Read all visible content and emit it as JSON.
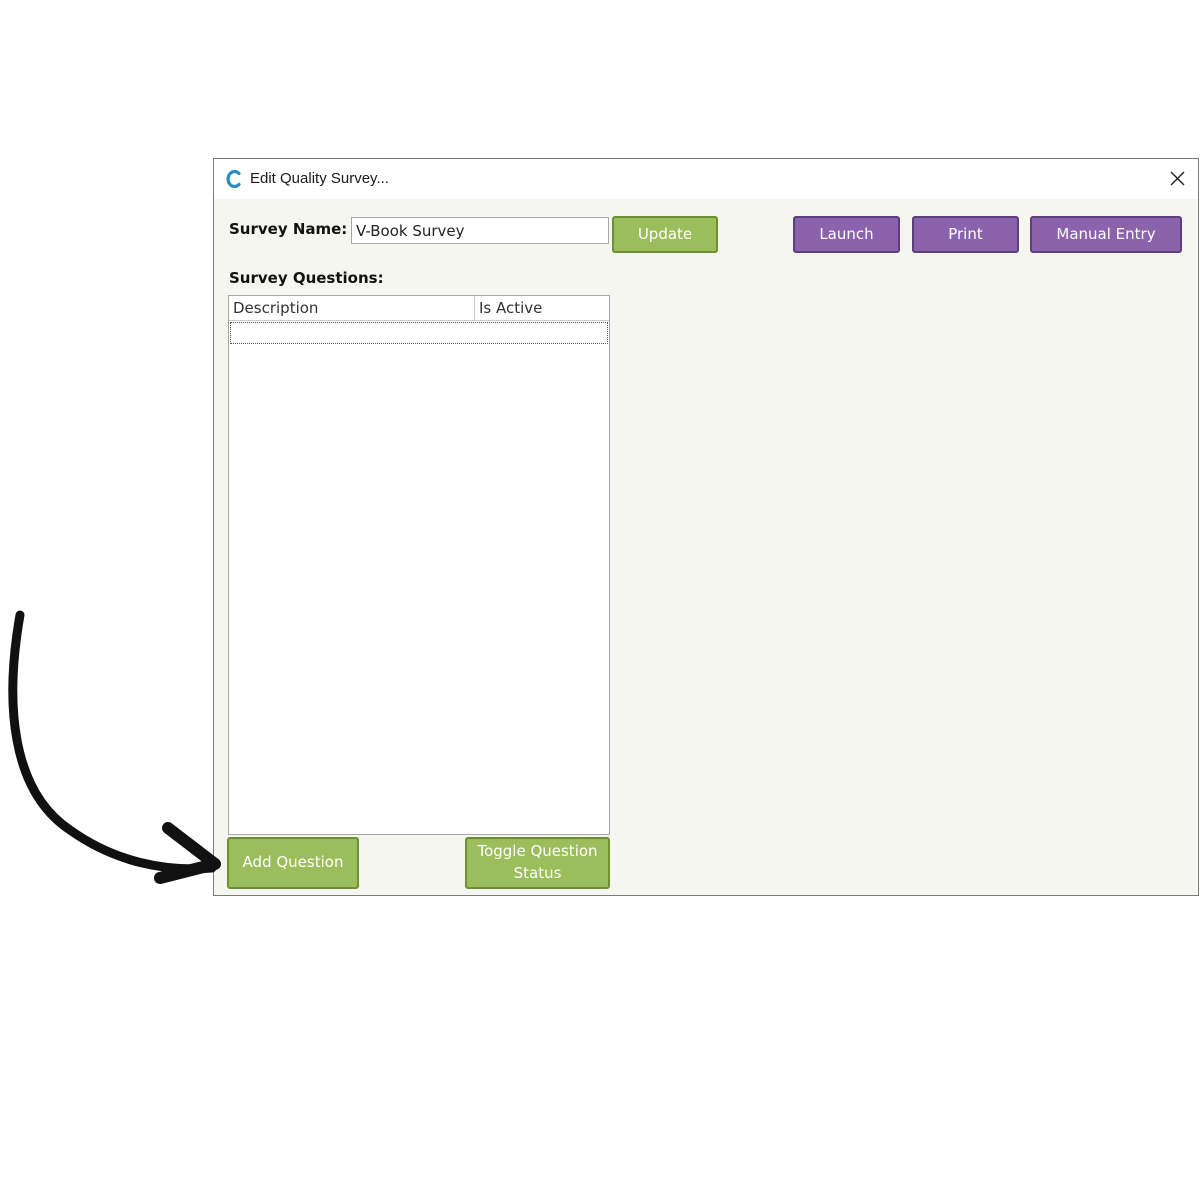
{
  "window": {
    "title": "Edit Quality Survey...",
    "icon": "app-c-logo-icon",
    "close_icon": "close-icon"
  },
  "form": {
    "survey_name_label": "Survey Name:",
    "survey_name_value": "V-Book Survey",
    "survey_questions_label": "Survey Questions:"
  },
  "buttons": {
    "update": "Update",
    "launch": "Launch",
    "print": "Print",
    "manual_entry": "Manual Entry",
    "add_question": "Add Question",
    "toggle_question_status": "Toggle Question Status"
  },
  "questions_table": {
    "columns": [
      "Description",
      "Is Active"
    ],
    "rows": []
  },
  "colors": {
    "green_button": "#9bbd5b",
    "purple_button": "#8a63ac",
    "dialog_background": "#f5f6ef"
  }
}
